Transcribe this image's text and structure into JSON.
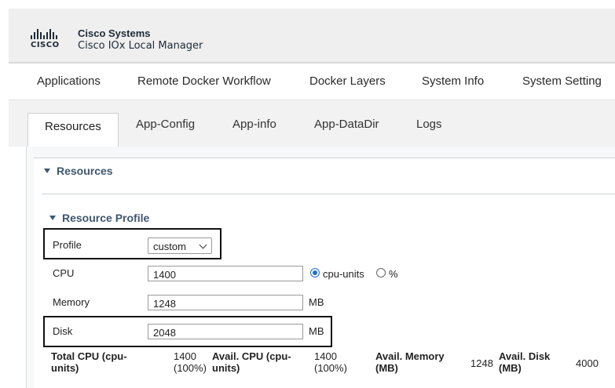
{
  "header": {
    "logo_text": "CISCO",
    "company": "Cisco Systems",
    "product": "Cisco IOx Local Manager"
  },
  "topnav": {
    "items": [
      "Applications",
      "Remote Docker Workflow",
      "Docker Layers",
      "System Info",
      "System Setting"
    ]
  },
  "tabs": {
    "items": [
      "Resources",
      "App-Config",
      "App-info",
      "App-DataDir",
      "Logs"
    ],
    "active": "Resources"
  },
  "resources_section": {
    "title": "Resources"
  },
  "resource_profile": {
    "title": "Resource Profile",
    "profile_label": "Profile",
    "profile_value": "custom",
    "cpu_label": "CPU",
    "cpu_value": "1400",
    "cpu_unit_options": [
      "cpu-units",
      "%"
    ],
    "cpu_unit_selected": "cpu-units",
    "memory_label": "Memory",
    "memory_value": "1248",
    "memory_unit": "MB",
    "disk_label": "Disk",
    "disk_value": "2048",
    "disk_unit": "MB"
  },
  "summary": {
    "total_cpu_label": "Total CPU (cpu-units)",
    "total_cpu_value": "1400 (100%)",
    "avail_cpu_label": "Avail. CPU (cpu-units)",
    "avail_cpu_value": "1400 (100%)",
    "avail_memory_label": "Avail. Memory (MB)",
    "avail_memory_value": "1248",
    "avail_disk_label": "Avail. Disk (MB)",
    "avail_disk_value": "4000"
  },
  "colors": {
    "section_heading": "#3e5670",
    "radio_selected": "#1f6fd0"
  }
}
